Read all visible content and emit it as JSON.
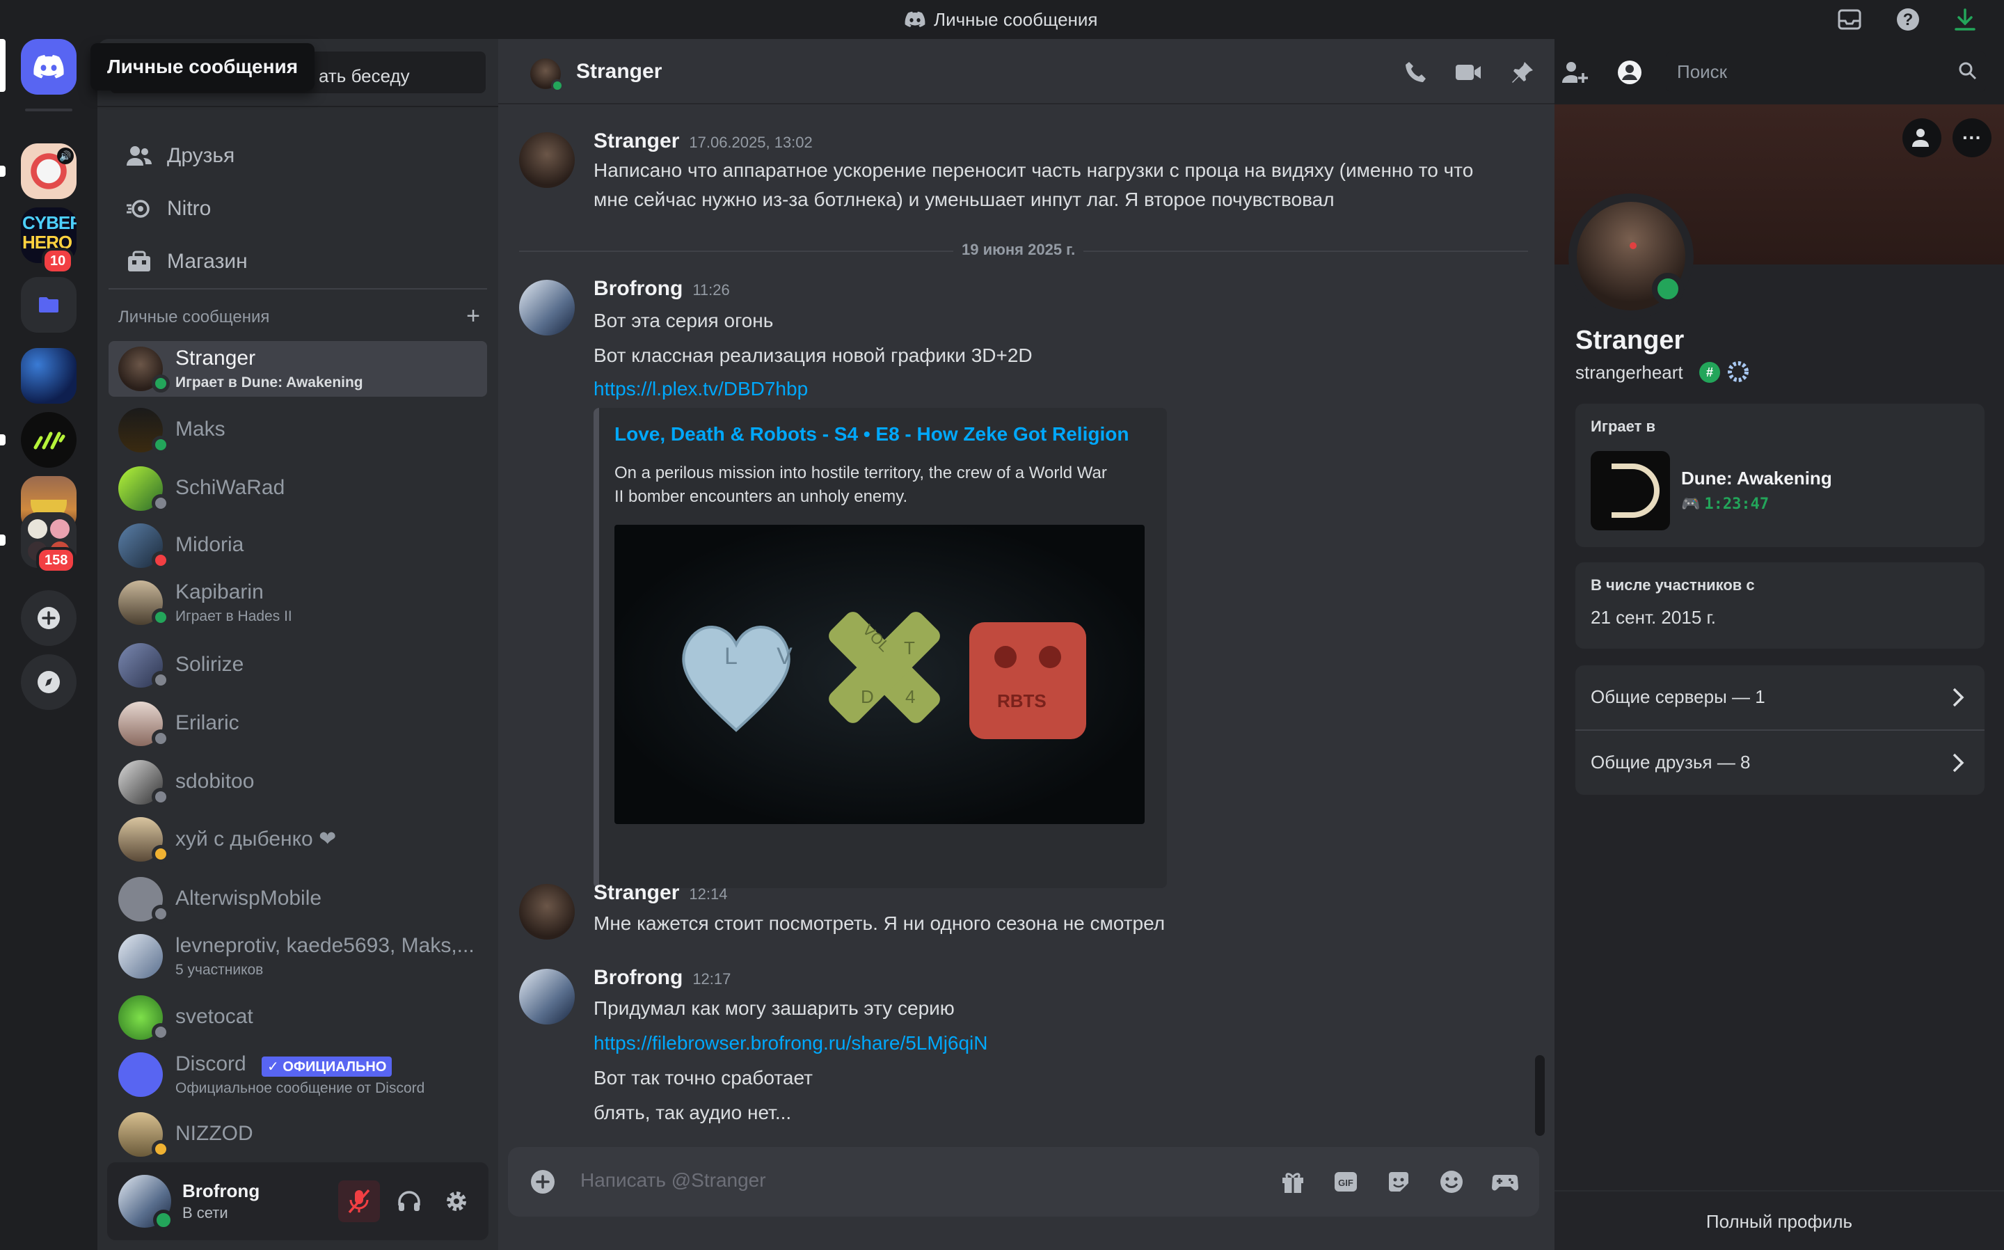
{
  "window": {
    "title": "Личные сообщения"
  },
  "tooltip": "Личные сообщения",
  "rail": {
    "badges": {
      "cyberhero": "10",
      "folder": "158"
    },
    "cyber_text_1": "CYBER",
    "cyber_text_2": "HERO"
  },
  "sidebar": {
    "search_placeholder": "Найти или начать беседу",
    "search_visible": "ать беседу",
    "nav": [
      "Друзья",
      "Nitro",
      "Магазин"
    ],
    "dm_header": "Личные сообщения",
    "dms": [
      {
        "name": "Stranger",
        "sub": "Играет в Dune: Awakening",
        "status": "online",
        "active": true
      },
      {
        "name": "Maks",
        "sub": "",
        "status": "online"
      },
      {
        "name": "SchiWaRad",
        "sub": "",
        "status": "offline"
      },
      {
        "name": "Midoria",
        "sub": "",
        "status": "dnd"
      },
      {
        "name": "Kapibarin",
        "sub": "Играет в Hades II",
        "status": "online"
      },
      {
        "name": "Solirize",
        "sub": "",
        "status": "offline"
      },
      {
        "name": "Erilaric",
        "sub": "",
        "status": "offline"
      },
      {
        "name": "sdobitoo",
        "sub": "",
        "status": "offline"
      },
      {
        "name": "хуй с дыбенко ❤",
        "sub": "",
        "status": "idle"
      },
      {
        "name": "AlterwispMobile",
        "sub": "",
        "status": "offline"
      },
      {
        "name": "levneprotiv, kaede5693, Maks,...",
        "sub": "5 участников",
        "status": ""
      },
      {
        "name": "svetocat",
        "sub": "",
        "status": "offline"
      },
      {
        "name": "Discord",
        "sub": "Официальное сообщение от Discord",
        "status": "",
        "tag": "✓ ОФИЦИАЛЬНО"
      },
      {
        "name": "NIZZOD",
        "sub": "",
        "status": "idle"
      }
    ]
  },
  "user": {
    "name": "Brofrong",
    "status": "В сети"
  },
  "chat": {
    "recipient": "Stranger",
    "search_placeholder": "Поиск",
    "composer_placeholder": "Написать @Stranger",
    "divider": "19 июня 2025 г.",
    "messages": [
      {
        "author": "Stranger",
        "time": "17.06.2025, 13:02",
        "lines": [
          "Написано что аппаратное ускорение переносит часть нагрузки с проца на видяху (именно то что",
          "мне сейчас нужно из-за ботлнека) и уменьшает инпут лаг. Я второе почувствовал"
        ]
      },
      {
        "author": "Brofrong",
        "time": "11:26",
        "lines": [
          "Вот эта серия огонь",
          "Вот классная реализация новой графики 3D+2D",
          "https://l.plex.tv/DBD7hbp"
        ]
      },
      {
        "author": "Stranger",
        "time": "12:14",
        "lines": [
          "Мне кажется стоит посмотреть. Я ни одного сезона не смотрел"
        ]
      },
      {
        "author": "Brofrong",
        "time": "12:17",
        "lines": [
          "Придумал как могу зашарить эту серию",
          "https://filebrowser.brofrong.ru/share/5LMj6qiN",
          "Вот так точно сработает",
          "блять, так аудио нет..."
        ]
      }
    ],
    "embed": {
      "title": "Love, Death & Robots - S4 • E8 - How Zeke Got Religion",
      "desc1": "On a perilous mission into hostile territory, the crew of a World War",
      "desc2": "II bomber encounters an unholy enemy.",
      "pill1": "L V",
      "pill2a": "VOL",
      "pill2b": "T",
      "pill2c": "D",
      "pill2d": "4",
      "pill3": "RBTS"
    }
  },
  "profile": {
    "name": "Stranger",
    "username": "strangerheart",
    "playing_label": "Играет в",
    "game": "Dune: Awakening",
    "game_time": "1:23:47",
    "member_since_label": "В числе участников с",
    "member_since": "21 сент. 2015 г.",
    "mutual_servers": "Общие серверы — 1",
    "mutual_friends": "Общие друзья — 8",
    "full_profile": "Полный профиль"
  },
  "colors": {
    "accent": "#5865f2",
    "link": "#00a8fc",
    "online": "#23a55a",
    "danger": "#f23f43"
  }
}
